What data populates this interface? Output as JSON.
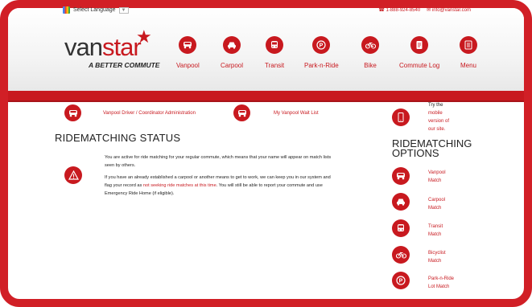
{
  "header": {
    "language_label": "Select Language",
    "language_arrow": "▼",
    "phone": "1-888-924-8540",
    "email": "info@vanstar.com",
    "logo_van": "van",
    "logo_star": "star",
    "tagline": "A BETTER COMMUTE",
    "nav": [
      {
        "label": "Vanpool",
        "icon": "van-icon"
      },
      {
        "label": "Carpool",
        "icon": "car-icon"
      },
      {
        "label": "Transit",
        "icon": "bus-icon"
      },
      {
        "label": "Park-n-Ride",
        "icon": "parking-icon"
      },
      {
        "label": "Bike",
        "icon": "bike-icon"
      },
      {
        "label": "Commute Log",
        "icon": "document-icon"
      },
      {
        "label": "Menu",
        "icon": "menu-icon"
      }
    ]
  },
  "main": {
    "admin_link": "Vanpool Driver / Coordinator Administration",
    "waitlist_link": "My Vanpool Wait List",
    "status_heading": "RIDEMATCHING STATUS",
    "para1": "You are active for ride matching for your regular commute, which means that your name will appear on match lists seen by others.",
    "para2_a": "If you have an already established a carpool or another means to get to work, we can keep you in our system and flag your record as ",
    "para2_link": "not seeking ride matches at this time",
    "para2_b": ". You will still be able to report your commute and use Emergency Ride Home (if eligible)."
  },
  "sidebar": {
    "mobile_try": "Try the",
    "mobile_link_1": "mobile",
    "mobile_link_2": "version of",
    "mobile_link_3": "our site.",
    "options_heading_1": "RIDEMATCHING",
    "options_heading_2": "OPTIONS",
    "options": [
      {
        "line1": "Vanpool",
        "line2": "Match"
      },
      {
        "line1": "Carpool",
        "line2": "Match"
      },
      {
        "line1": "Transit",
        "line2": "Match"
      },
      {
        "line1": "Bicyclist",
        "line2": "Match"
      },
      {
        "line1": "Park-n-Ride",
        "line2": "Lot Match"
      }
    ]
  },
  "colors": {
    "brand_red": "#c8191f",
    "text": "#222222"
  }
}
